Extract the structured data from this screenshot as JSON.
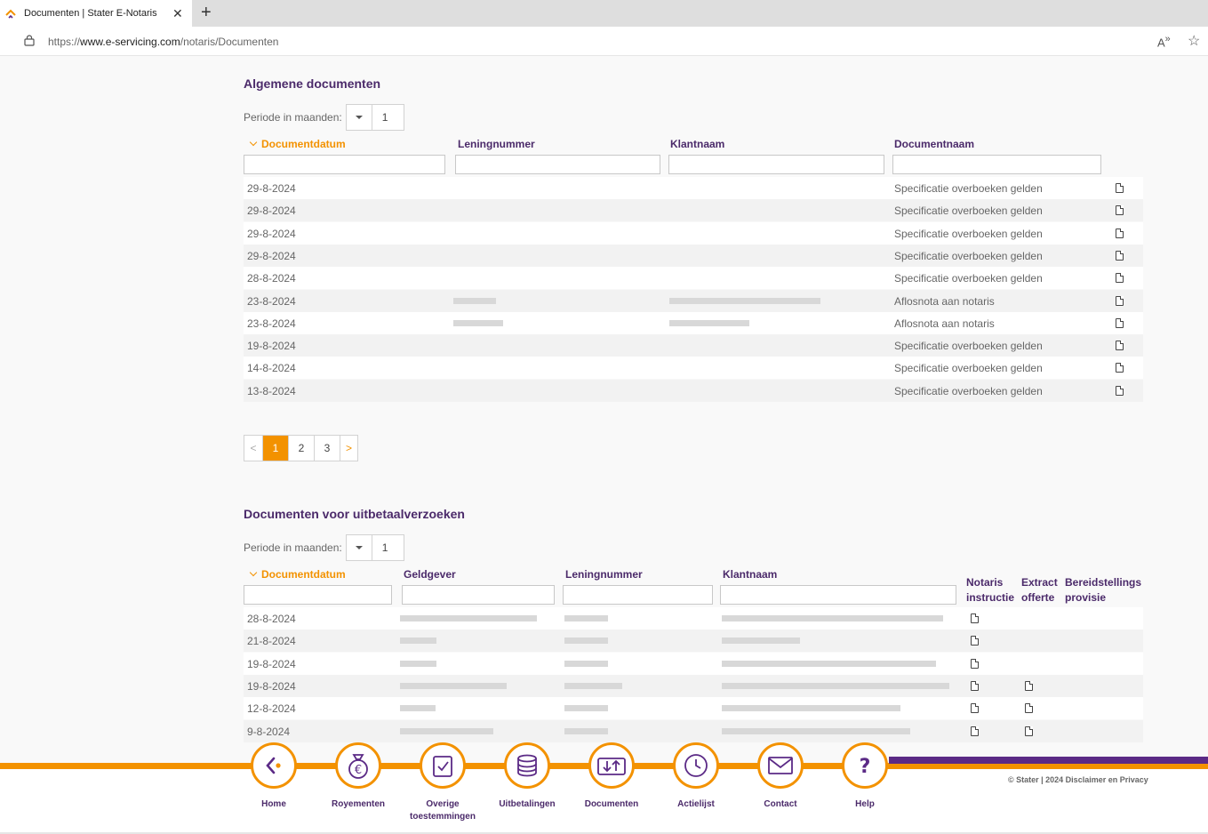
{
  "browser": {
    "tab_title": "Documenten | Stater E-Notaris",
    "url_prefix": "https://",
    "url_host": "www.e-servicing.com",
    "url_path": "/notaris/Documenten"
  },
  "section1": {
    "title": "Algemene documenten",
    "periode_label": "Periode in maanden:",
    "periode_value": "1",
    "headers": [
      "Documentdatum",
      "Leningnummer",
      "Klantnaam",
      "Documentnaam"
    ],
    "rows": [
      {
        "date": "29-8-2024",
        "doc": "Specificatie overboeken gelden"
      },
      {
        "date": "29-8-2024",
        "doc": "Specificatie overboeken gelden"
      },
      {
        "date": "29-8-2024",
        "doc": "Specificatie overboeken gelden"
      },
      {
        "date": "29-8-2024",
        "doc": "Specificatie overboeken gelden"
      },
      {
        "date": "28-8-2024",
        "doc": "Specificatie overboeken gelden"
      },
      {
        "date": "23-8-2024",
        "doc": "Aflosnota aan notaris"
      },
      {
        "date": "23-8-2024",
        "doc": "Aflosnota aan notaris"
      },
      {
        "date": "19-8-2024",
        "doc": "Specificatie overboeken gelden"
      },
      {
        "date": "14-8-2024",
        "doc": "Specificatie overboeken gelden"
      },
      {
        "date": "13-8-2024",
        "doc": "Specificatie overboeken gelden"
      }
    ],
    "pages": [
      "1",
      "2",
      "3"
    ],
    "prev_glyph": "<",
    "next_glyph": ">"
  },
  "section2": {
    "title": "Documenten voor uitbetaalverzoeken",
    "periode_label": "Periode in maanden:",
    "periode_value": "1",
    "headers": [
      "Documentdatum",
      "Geldgever",
      "Leningnummer",
      "Klantnaam"
    ],
    "notaris_l1": "Notaris",
    "notaris_l2": "instructie",
    "extract_l1": "Extract",
    "extract_l2": "offerte",
    "bereid_l1": "Bereidstellings",
    "bereid_l2": "provisie",
    "rows": [
      {
        "date": "28-8-2024",
        "extract": false
      },
      {
        "date": "21-8-2024",
        "extract": false
      },
      {
        "date": "19-8-2024",
        "extract": false
      },
      {
        "date": "19-8-2024",
        "extract": true
      },
      {
        "date": "12-8-2024",
        "extract": true
      },
      {
        "date": "9-8-2024",
        "extract": true
      }
    ]
  },
  "nav": [
    {
      "label": "Home",
      "icon": "home-back-icon"
    },
    {
      "label": "Royementen",
      "icon": "money-bag-icon"
    },
    {
      "label": "Overige toestemmingen",
      "icon": "clipboard-check-icon"
    },
    {
      "label": "Uitbetalingen",
      "icon": "coin-stack-icon"
    },
    {
      "label": "Documenten",
      "icon": "document-transfer-icon"
    },
    {
      "label": "Actielijst",
      "icon": "clock-icon"
    },
    {
      "label": "Contact",
      "icon": "envelope-icon"
    },
    {
      "label": "Help",
      "icon": "question-icon"
    }
  ],
  "footer": {
    "copyright": "© Stater | 2024 Disclaimer en Privacy"
  },
  "colors": {
    "orange": "#f39200",
    "purple": "#4b2a6a"
  }
}
